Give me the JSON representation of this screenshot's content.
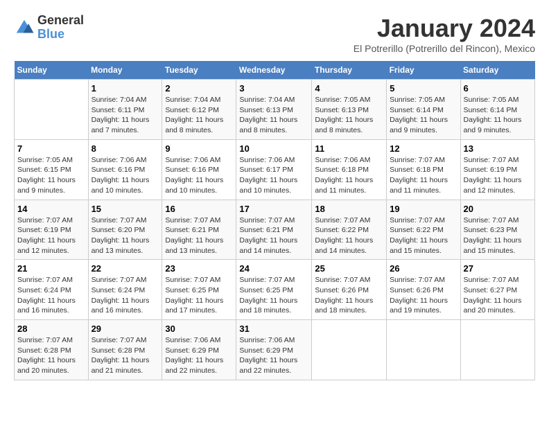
{
  "logo": {
    "general": "General",
    "blue": "Blue"
  },
  "title": "January 2024",
  "subtitle": "El Potrerillo (Potrerillo del Rincon), Mexico",
  "days_of_week": [
    "Sunday",
    "Monday",
    "Tuesday",
    "Wednesday",
    "Thursday",
    "Friday",
    "Saturday"
  ],
  "weeks": [
    [
      {
        "day": "",
        "info": ""
      },
      {
        "day": "1",
        "info": "Sunrise: 7:04 AM\nSunset: 6:11 PM\nDaylight: 11 hours\nand 7 minutes."
      },
      {
        "day": "2",
        "info": "Sunrise: 7:04 AM\nSunset: 6:12 PM\nDaylight: 11 hours\nand 8 minutes."
      },
      {
        "day": "3",
        "info": "Sunrise: 7:04 AM\nSunset: 6:13 PM\nDaylight: 11 hours\nand 8 minutes."
      },
      {
        "day": "4",
        "info": "Sunrise: 7:05 AM\nSunset: 6:13 PM\nDaylight: 11 hours\nand 8 minutes."
      },
      {
        "day": "5",
        "info": "Sunrise: 7:05 AM\nSunset: 6:14 PM\nDaylight: 11 hours\nand 9 minutes."
      },
      {
        "day": "6",
        "info": "Sunrise: 7:05 AM\nSunset: 6:14 PM\nDaylight: 11 hours\nand 9 minutes."
      }
    ],
    [
      {
        "day": "7",
        "info": "Sunrise: 7:05 AM\nSunset: 6:15 PM\nDaylight: 11 hours\nand 9 minutes."
      },
      {
        "day": "8",
        "info": "Sunrise: 7:06 AM\nSunset: 6:16 PM\nDaylight: 11 hours\nand 10 minutes."
      },
      {
        "day": "9",
        "info": "Sunrise: 7:06 AM\nSunset: 6:16 PM\nDaylight: 11 hours\nand 10 minutes."
      },
      {
        "day": "10",
        "info": "Sunrise: 7:06 AM\nSunset: 6:17 PM\nDaylight: 11 hours\nand 10 minutes."
      },
      {
        "day": "11",
        "info": "Sunrise: 7:06 AM\nSunset: 6:18 PM\nDaylight: 11 hours\nand 11 minutes."
      },
      {
        "day": "12",
        "info": "Sunrise: 7:07 AM\nSunset: 6:18 PM\nDaylight: 11 hours\nand 11 minutes."
      },
      {
        "day": "13",
        "info": "Sunrise: 7:07 AM\nSunset: 6:19 PM\nDaylight: 11 hours\nand 12 minutes."
      }
    ],
    [
      {
        "day": "14",
        "info": "Sunrise: 7:07 AM\nSunset: 6:19 PM\nDaylight: 11 hours\nand 12 minutes."
      },
      {
        "day": "15",
        "info": "Sunrise: 7:07 AM\nSunset: 6:20 PM\nDaylight: 11 hours\nand 13 minutes."
      },
      {
        "day": "16",
        "info": "Sunrise: 7:07 AM\nSunset: 6:21 PM\nDaylight: 11 hours\nand 13 minutes."
      },
      {
        "day": "17",
        "info": "Sunrise: 7:07 AM\nSunset: 6:21 PM\nDaylight: 11 hours\nand 14 minutes."
      },
      {
        "day": "18",
        "info": "Sunrise: 7:07 AM\nSunset: 6:22 PM\nDaylight: 11 hours\nand 14 minutes."
      },
      {
        "day": "19",
        "info": "Sunrise: 7:07 AM\nSunset: 6:22 PM\nDaylight: 11 hours\nand 15 minutes."
      },
      {
        "day": "20",
        "info": "Sunrise: 7:07 AM\nSunset: 6:23 PM\nDaylight: 11 hours\nand 15 minutes."
      }
    ],
    [
      {
        "day": "21",
        "info": "Sunrise: 7:07 AM\nSunset: 6:24 PM\nDaylight: 11 hours\nand 16 minutes."
      },
      {
        "day": "22",
        "info": "Sunrise: 7:07 AM\nSunset: 6:24 PM\nDaylight: 11 hours\nand 16 minutes."
      },
      {
        "day": "23",
        "info": "Sunrise: 7:07 AM\nSunset: 6:25 PM\nDaylight: 11 hours\nand 17 minutes."
      },
      {
        "day": "24",
        "info": "Sunrise: 7:07 AM\nSunset: 6:25 PM\nDaylight: 11 hours\nand 18 minutes."
      },
      {
        "day": "25",
        "info": "Sunrise: 7:07 AM\nSunset: 6:26 PM\nDaylight: 11 hours\nand 18 minutes."
      },
      {
        "day": "26",
        "info": "Sunrise: 7:07 AM\nSunset: 6:26 PM\nDaylight: 11 hours\nand 19 minutes."
      },
      {
        "day": "27",
        "info": "Sunrise: 7:07 AM\nSunset: 6:27 PM\nDaylight: 11 hours\nand 20 minutes."
      }
    ],
    [
      {
        "day": "28",
        "info": "Sunrise: 7:07 AM\nSunset: 6:28 PM\nDaylight: 11 hours\nand 20 minutes."
      },
      {
        "day": "29",
        "info": "Sunrise: 7:07 AM\nSunset: 6:28 PM\nDaylight: 11 hours\nand 21 minutes."
      },
      {
        "day": "30",
        "info": "Sunrise: 7:06 AM\nSunset: 6:29 PM\nDaylight: 11 hours\nand 22 minutes."
      },
      {
        "day": "31",
        "info": "Sunrise: 7:06 AM\nSunset: 6:29 PM\nDaylight: 11 hours\nand 22 minutes."
      },
      {
        "day": "",
        "info": ""
      },
      {
        "day": "",
        "info": ""
      },
      {
        "day": "",
        "info": ""
      }
    ]
  ]
}
